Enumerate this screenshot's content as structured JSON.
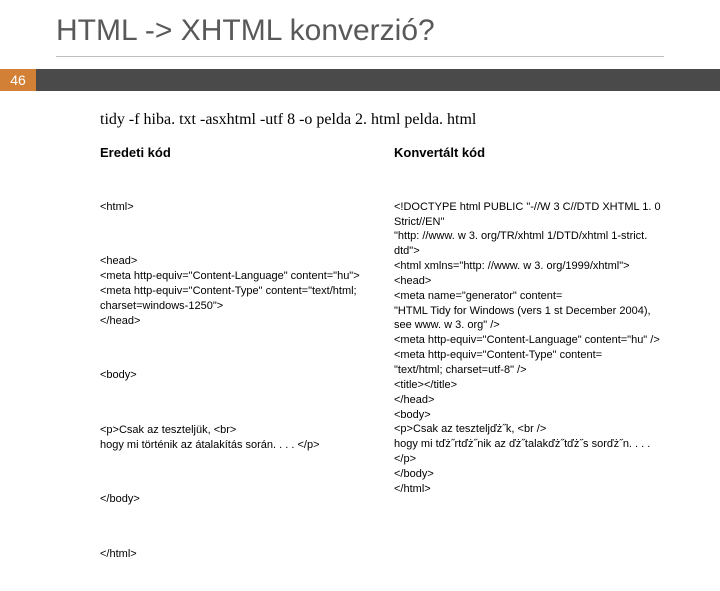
{
  "slide": {
    "title": "HTML -> XHTML konverzió?",
    "number": "46",
    "command": "tidy -f hiba. txt -asxhtml -utf 8 -o pelda 2. html pelda. html",
    "left": {
      "heading": "Eredeti kód",
      "b1": "<html>",
      "b2": "<head>\n<meta http-equiv=\"Content-Language\" content=\"hu\">\n<meta http-equiv=\"Content-Type\" content=\"text/html; charset=windows-1250\">\n</head>",
      "b3": "<body>",
      "b4": "<p>Csak az teszteljük, <br>\nhogy mi történik az átalakítás során. . . . </p>",
      "b5": "</body>",
      "b6": "</html>"
    },
    "right": {
      "heading": "Konvertált kód",
      "b1": "<!DOCTYPE html PUBLIC \"-//W 3 C//DTD XHTML 1. 0 Strict//EN\"\n\"http: //www. w 3. org/TR/xhtml 1/DTD/xhtml 1-strict. dtd\">\n<html xmlns=\"http: //www. w 3. org/1999/xhtml\">\n<head>\n<meta name=\"generator\" content=\n\"HTML Tidy for Windows (vers 1 st December 2004), see www. w 3. org\" />\n<meta http-equiv=\"Content-Language\" content=\"hu\" />\n<meta http-equiv=\"Content-Type\" content=\n\"text/html; charset=utf-8\" />\n<title></title>\n</head>\n<body>\n<p>Csak az teszteljďż˝k, <br />\nhogy mi tďż˝rtďż˝nik az ďż˝talakďż˝tďż˝s sorďż˝n. . . . </p>\n</body>\n</html>"
    }
  }
}
